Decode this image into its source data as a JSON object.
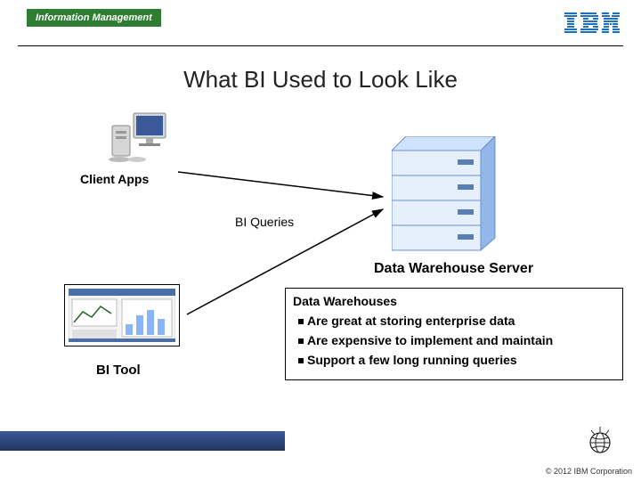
{
  "header": {
    "brand": "Information Management"
  },
  "title": "What BI Used to Look Like",
  "diagram": {
    "client_label": "Client Apps",
    "queries_label": "BI Queries",
    "server_label": "Data Warehouse Server",
    "bitool_label": "BI Tool"
  },
  "callout": {
    "heading": "Data Warehouses",
    "items": [
      "Are great at storing enterprise data",
      "Are expensive to implement and maintain",
      "Support a few long running queries"
    ]
  },
  "footer": {
    "copyright": "© 2012 IBM Corporation"
  }
}
